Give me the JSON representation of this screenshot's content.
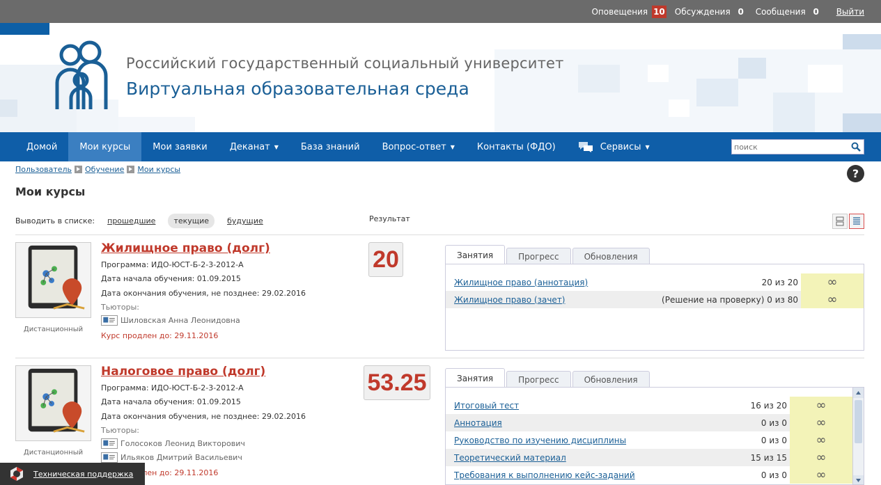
{
  "topbar": {
    "notifications_label": "Оповещения",
    "notifications_count": "10",
    "discussions_label": "Обсуждения",
    "discussions_count": "0",
    "messages_label": "Сообщения",
    "messages_count": "0",
    "exit_label": "Выйти"
  },
  "header": {
    "title1": "Российский государственный социальный университет",
    "title2": "Виртуальная образовательная среда",
    "logo_icon": "family-logo-icon"
  },
  "nav": {
    "items": [
      {
        "label": "Домой"
      },
      {
        "label": "Мои курсы"
      },
      {
        "label": "Мои заявки"
      },
      {
        "label": "Деканат"
      },
      {
        "label": "База знаний"
      },
      {
        "label": "Вопрос-ответ"
      },
      {
        "label": "Контакты (ФДО)"
      },
      {
        "label": "Сервисы"
      }
    ],
    "search_placeholder": "поиск"
  },
  "breadcrumb": [
    "Пользователь",
    "Обучение",
    "Мои курсы"
  ],
  "help_label": "?",
  "page_title": "Мои курсы",
  "filters": {
    "label": "Выводить в списке:",
    "past": "прошедшие",
    "current": "текущие",
    "future": "будущие"
  },
  "result_header": "Результат",
  "tabs": {
    "lessons": "Занятия",
    "progress": "Прогресс",
    "updates": "Обновления"
  },
  "courses": [
    {
      "title": "Жилищное право (долг)",
      "program": "Программа: ИДО-ЮСТ-Б-2-3-2012-А",
      "start": "Дата начала обучения: 01.09.2015",
      "end": "Дата окончания обучения, не позднее: 29.02.2016",
      "tutors_label": "Тьюторы:",
      "tutors": [
        "Шиловская Анна Леонидовна"
      ],
      "extended": "Курс продлен до: 29.11.2016",
      "mode": "Дистанционный",
      "score": "20",
      "lessons": [
        {
          "name": "Жилищное право (аннотация)",
          "value": "20 из 20",
          "inf": "∞"
        },
        {
          "name": "Жилищное право (зачет)",
          "value": "(Решение на проверку) 0 из 80",
          "inf": "∞"
        }
      ]
    },
    {
      "title": "Налоговое право (долг)",
      "program": "Программа: ИДО-ЮСТ-Б-2-3-2012-А",
      "start": "Дата начала обучения: 01.09.2015",
      "end": "Дата окончания обучения, не позднее: 29.02.2016",
      "tutors_label": "Тьюторы:",
      "tutors": [
        "Голосоков Леонид Викторович",
        "Ильяков Дмитрий Васильевич"
      ],
      "extended": "Курс продлен до: 29.11.2016",
      "mode": "Дистанционный",
      "score": "53.25",
      "lessons": [
        {
          "name": "Итоговый тест",
          "value": "16 из 20",
          "inf": "∞"
        },
        {
          "name": "Аннотация",
          "value": "0 из 0",
          "inf": "∞"
        },
        {
          "name": "Руководство по изучению дисциплины",
          "value": "0 из 0",
          "inf": "∞"
        },
        {
          "name": "Теоретический материал",
          "value": "15 из 15",
          "inf": "∞"
        },
        {
          "name": "Требования к выполнению кейс-заданий",
          "value": "0 из 0",
          "inf": "∞"
        }
      ]
    }
  ],
  "support_label": "Техническая поддержка",
  "colors": {
    "nav_bg": "#0f5ea8",
    "accent_red": "#c0392b",
    "link_blue": "#1a5f96",
    "infinity_bg": "#f3f3b8"
  }
}
